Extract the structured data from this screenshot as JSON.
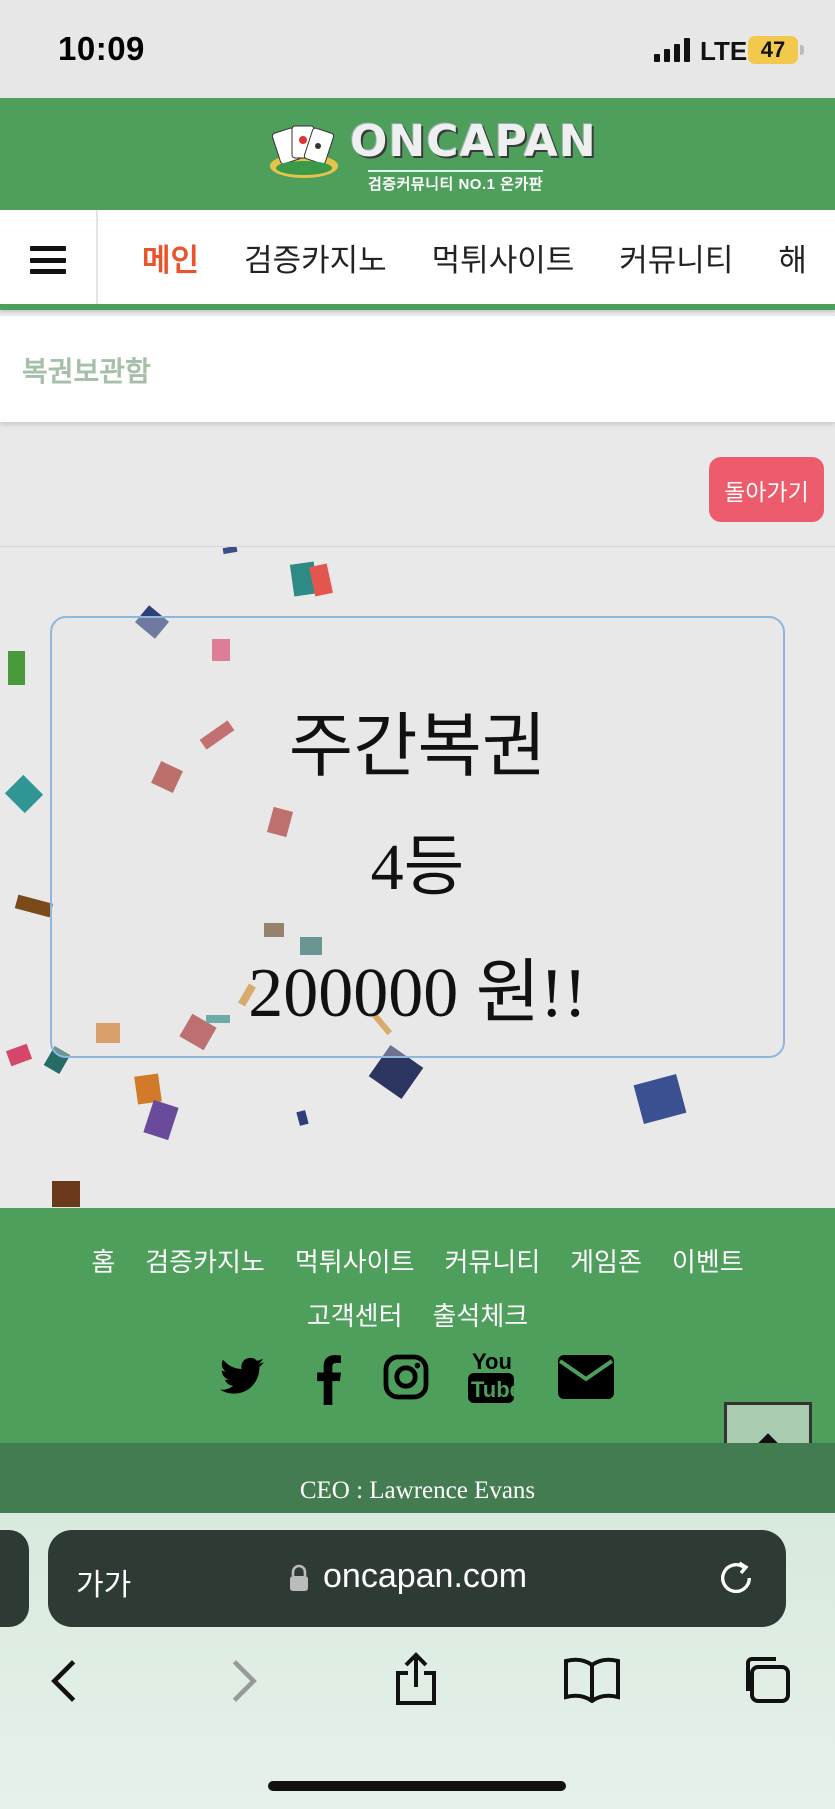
{
  "status_bar": {
    "time": "10:09",
    "network": "LTE",
    "battery": "47"
  },
  "header": {
    "logo_text": "ONCAPAN",
    "logo_subtitle": "검증커뮤니티 NO.1 온카판"
  },
  "nav": {
    "items": [
      {
        "label": "메인",
        "active": true
      },
      {
        "label": "검증카지노"
      },
      {
        "label": "먹튀사이트"
      },
      {
        "label": "커뮤니티"
      },
      {
        "label": "해"
      }
    ]
  },
  "page": {
    "title": "복권보관함",
    "back_button": "돌아가기"
  },
  "result": {
    "lottery_name": "주간복권",
    "rank": "4등",
    "prize": "200000 원!!"
  },
  "footer": {
    "links": [
      "홈",
      "검증카지노",
      "먹튀사이트",
      "커뮤니티",
      "게임존",
      "이벤트",
      "고객센터",
      "출석체크"
    ],
    "social": [
      "twitter-icon",
      "facebook-icon",
      "instagram-icon",
      "youtube-icon",
      "email-icon"
    ],
    "ceo": "CEO : Lawrence Evans"
  },
  "browser": {
    "text_size_label": "가가",
    "url": "oncapan.com"
  },
  "colors": {
    "brand_green": "#4e9f5b",
    "active_nav": "#e8542b",
    "back_button": "#ec5c6c"
  }
}
